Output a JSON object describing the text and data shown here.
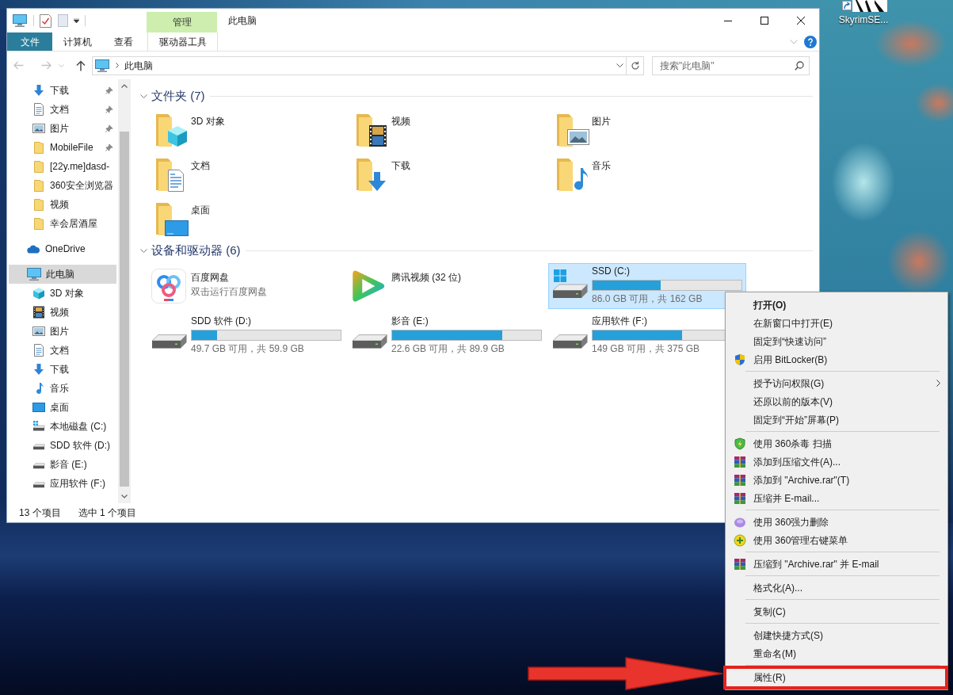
{
  "desktop": {
    "shortcuts": [
      {
        "label": "SkyrimSE..."
      }
    ]
  },
  "window": {
    "title": "此电脑",
    "contextual_group": "管理"
  },
  "ribbon": {
    "tabs": [
      {
        "label": "文件",
        "kind": "file"
      },
      {
        "label": "计算机",
        "kind": "tab"
      },
      {
        "label": "查看",
        "kind": "tab"
      },
      {
        "label": "驱动器工具",
        "kind": "contextual"
      }
    ]
  },
  "navigation": {
    "buttons": [
      {
        "kind": "back",
        "disabled": true
      },
      {
        "kind": "forward",
        "disabled": true
      },
      {
        "kind": "recent",
        "disabled": true
      },
      {
        "kind": "up",
        "disabled": false
      }
    ]
  },
  "address_bar": {
    "path": [
      "此电脑"
    ]
  },
  "search": {
    "placeholder": "搜索\"此电脑\""
  },
  "sidebar": {
    "quick_access": [
      {
        "label": "下载",
        "kind": "download",
        "pinned": true,
        "selected": false
      },
      {
        "label": "文档",
        "kind": "document",
        "pinned": true,
        "selected": false
      },
      {
        "label": "图片",
        "kind": "picture",
        "pinned": true,
        "selected": false
      },
      {
        "label": "MobileFile",
        "kind": "folder",
        "pinned": true,
        "selected": false
      },
      {
        "label": "[22y.me]dasd-",
        "kind": "folder",
        "pinned": false,
        "selected": false
      },
      {
        "label": "360安全浏览器",
        "kind": "folder",
        "pinned": false,
        "selected": false
      },
      {
        "label": "视频",
        "kind": "folder",
        "pinned": false,
        "selected": false
      },
      {
        "label": "幸会居酒屋",
        "kind": "folder",
        "pinned": false,
        "selected": false
      }
    ],
    "items": [
      {
        "label": "OneDrive",
        "kind": "cloud",
        "selected": false
      },
      {
        "label": "此电脑",
        "kind": "pc",
        "selected": true,
        "children": [
          {
            "label": "3D 对象",
            "kind": "cube",
            "selected": false
          },
          {
            "label": "视频",
            "kind": "video",
            "selected": false
          },
          {
            "label": "图片",
            "kind": "picture",
            "selected": false
          },
          {
            "label": "文档",
            "kind": "document",
            "selected": false
          },
          {
            "label": "下载",
            "kind": "download",
            "selected": false
          },
          {
            "label": "音乐",
            "kind": "music",
            "selected": false
          },
          {
            "label": "桌面",
            "kind": "desktop",
            "selected": false
          },
          {
            "label": "本地磁盘 (C:)",
            "kind": "system",
            "selected": false
          },
          {
            "label": "SDD 软件 (D:)",
            "kind": "drive",
            "selected": false
          },
          {
            "label": "影音 (E:)",
            "kind": "drive",
            "selected": false
          },
          {
            "label": "应用软件 (F:)",
            "kind": "drive",
            "selected": false
          }
        ]
      }
    ]
  },
  "content": {
    "groups": [
      {
        "title": "文件夹 (7)",
        "expanded": true,
        "items": [
          {
            "label": "3D 对象",
            "kind": "cube",
            "selected": false
          },
          {
            "label": "视频",
            "kind": "video",
            "selected": false
          },
          {
            "label": "图片",
            "kind": "picture",
            "selected": false
          },
          {
            "label": "文档",
            "kind": "document",
            "selected": false
          },
          {
            "label": "下载",
            "kind": "download",
            "selected": false
          },
          {
            "label": "音乐",
            "kind": "music",
            "selected": false
          },
          {
            "label": "桌面",
            "kind": "desktop",
            "selected": false
          }
        ]
      },
      {
        "title": "设备和驱动器 (6)",
        "expanded": true,
        "items": [
          {
            "label": "百度网盘",
            "kind": "cloud",
            "subtitle": "双击运行百度网盘",
            "selected": false
          },
          {
            "label": "腾讯视频 (32 位)",
            "kind": "player",
            "selected": false
          },
          {
            "label": "SSD (C:)",
            "kind": "system",
            "level": 0.46,
            "reading": "86.0 GB 可用，共 162 GB",
            "selected": true
          },
          {
            "label": "SDD 软件 (D:)",
            "kind": "drive",
            "level": 0.17,
            "reading": "49.7 GB 可用，共 59.9 GB",
            "selected": false
          },
          {
            "label": "影音 (E:)",
            "kind": "drive",
            "level": 0.74,
            "reading": "22.6 GB 可用，共 89.9 GB",
            "selected": false
          },
          {
            "label": "应用软件 (F:)",
            "kind": "drive",
            "level": 0.6,
            "reading": "149 GB 可用，共 375 GB",
            "selected": false
          }
        ]
      }
    ]
  },
  "status_bar": {
    "item_count": "13 个项目",
    "selection": "选中 1 个项目"
  },
  "context_menu": {
    "items": [
      {
        "kind": "default",
        "label": "打开(O)",
        "annotated": false
      },
      {
        "kind": "plain",
        "label": "在新窗口中打开(E)",
        "annotated": false
      },
      {
        "kind": "plain",
        "label": "固定到“快速访问”",
        "annotated": false
      },
      {
        "kind": "uac",
        "label": "启用 BitLocker(B)",
        "annotated": false
      },
      {
        "kind": "separator"
      },
      {
        "kind": "submenu",
        "label": "授予访问权限(G)",
        "annotated": false
      },
      {
        "kind": "plain",
        "label": "还原以前的版本(V)",
        "annotated": false
      },
      {
        "kind": "plain",
        "label": "固定到“开始”屏幕(P)",
        "annotated": false
      },
      {
        "kind": "separator"
      },
      {
        "kind": "antivirus",
        "label": "使用 360杀毒 扫描",
        "annotated": false
      },
      {
        "kind": "archive",
        "label": "添加到压缩文件(A)...",
        "annotated": false
      },
      {
        "kind": "archive",
        "label": "添加到 \"Archive.rar\"(T)",
        "annotated": false
      },
      {
        "kind": "archive",
        "label": "压缩并 E-mail...",
        "annotated": false
      },
      {
        "kind": "separator"
      },
      {
        "kind": "shredder",
        "label": "使用 360强力删除",
        "annotated": false
      },
      {
        "kind": "manager",
        "label": "使用 360管理右键菜单",
        "annotated": false
      },
      {
        "kind": "separator"
      },
      {
        "kind": "archive",
        "label": "压缩到 \"Archive.rar\" 并 E-mail",
        "annotated": false
      },
      {
        "kind": "separator"
      },
      {
        "kind": "plain",
        "label": "格式化(A)...",
        "annotated": false
      },
      {
        "kind": "separator"
      },
      {
        "kind": "plain",
        "label": "复制(C)",
        "annotated": false
      },
      {
        "kind": "separator"
      },
      {
        "kind": "plain",
        "label": "创建快捷方式(S)",
        "annotated": false
      },
      {
        "kind": "plain",
        "label": "重命名(M)",
        "annotated": false
      },
      {
        "kind": "separator"
      },
      {
        "kind": "plain",
        "label": "属性(R)",
        "annotated": true
      }
    ]
  }
}
